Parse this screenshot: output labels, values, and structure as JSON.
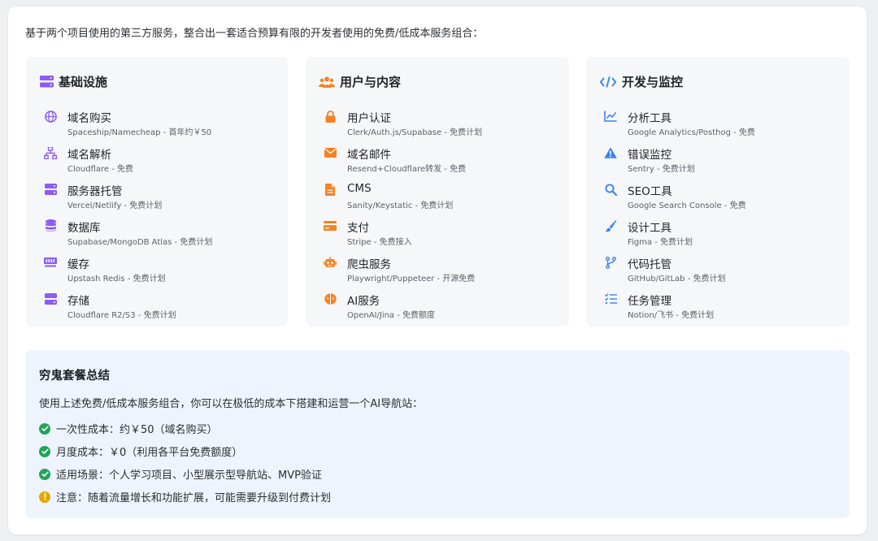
{
  "intro": "基于两个项目使用的第三方服务，整合出一套适合预算有限的开发者使用的免费/低成本服务组合：",
  "colors": {
    "purple": "#8b5cf6",
    "orange": "#f58220",
    "blue": "#3b82f6",
    "green": "#22a559",
    "amber": "#e0a800"
  },
  "columns": [
    {
      "title": "基础设施",
      "icon": "server-icon",
      "items": [
        {
          "title": "域名购买",
          "desc": "Spaceship/Namecheap - 首年约￥50",
          "icon": "globe-icon"
        },
        {
          "title": "域名解析",
          "desc": "Cloudflare - 免费",
          "icon": "sitemap-icon"
        },
        {
          "title": "服务器托管",
          "desc": "Vercel/Netlify - 免费计划",
          "icon": "server-icon"
        },
        {
          "title": "数据库",
          "desc": "Supabase/MongoDB Atlas - 免费计划",
          "icon": "database-icon"
        },
        {
          "title": "缓存",
          "desc": "Upstash Redis - 免费计划",
          "icon": "memory-icon"
        },
        {
          "title": "存储",
          "desc": "Cloudflare R2/S3 - 免费计划",
          "icon": "hdd-icon"
        }
      ]
    },
    {
      "title": "用户与内容",
      "icon": "users-icon",
      "items": [
        {
          "title": "用户认证",
          "desc": "Clerk/Auth.js/Supabase - 免费计划",
          "icon": "lock-icon"
        },
        {
          "title": "域名邮件",
          "desc": "Resend+Cloudflare转发 - 免费",
          "icon": "envelope-icon"
        },
        {
          "title": "CMS",
          "desc": "Sanity/Keystatic - 免费计划",
          "icon": "file-icon"
        },
        {
          "title": "支付",
          "desc": "Stripe - 免费接入",
          "icon": "credit-card-icon"
        },
        {
          "title": "爬虫服务",
          "desc": "Playwright/Puppeteer - 开源免费",
          "icon": "robot-icon"
        },
        {
          "title": "AI服务",
          "desc": "OpenAI/Jina - 免费额度",
          "icon": "brain-icon"
        }
      ]
    },
    {
      "title": "开发与监控",
      "icon": "code-icon",
      "items": [
        {
          "title": "分析工具",
          "desc": "Google Analytics/Posthog - 免费",
          "icon": "chart-line-icon"
        },
        {
          "title": "错误监控",
          "desc": "Sentry - 免费计划",
          "icon": "warning-icon"
        },
        {
          "title": "SEO工具",
          "desc": "Google Search Console - 免费",
          "icon": "search-icon"
        },
        {
          "title": "设计工具",
          "desc": "Figma - 免费计划",
          "icon": "paint-brush-icon"
        },
        {
          "title": "代码托管",
          "desc": "GitHub/GitLab - 免费计划",
          "icon": "code-branch-icon"
        },
        {
          "title": "任务管理",
          "desc": "Notion/飞书 - 免费计划",
          "icon": "tasks-icon"
        }
      ]
    }
  ],
  "summary": {
    "title": "穷鬼套餐总结",
    "desc": "使用上述免费/低成本服务组合，你可以在极低的成本下搭建和运营一个AI导航站：",
    "items": [
      {
        "text": "一次性成本：约￥50（域名购买）",
        "icon": "check-circle-icon"
      },
      {
        "text": "月度成本：￥0（利用各平台免费额度）",
        "icon": "check-circle-icon"
      },
      {
        "text": "适用场景：个人学习项目、小型展示型导航站、MVP验证",
        "icon": "check-circle-icon"
      },
      {
        "text": "注意：随着流量增长和功能扩展，可能需要升级到付费计划",
        "icon": "exclamation-circle-icon"
      }
    ]
  }
}
